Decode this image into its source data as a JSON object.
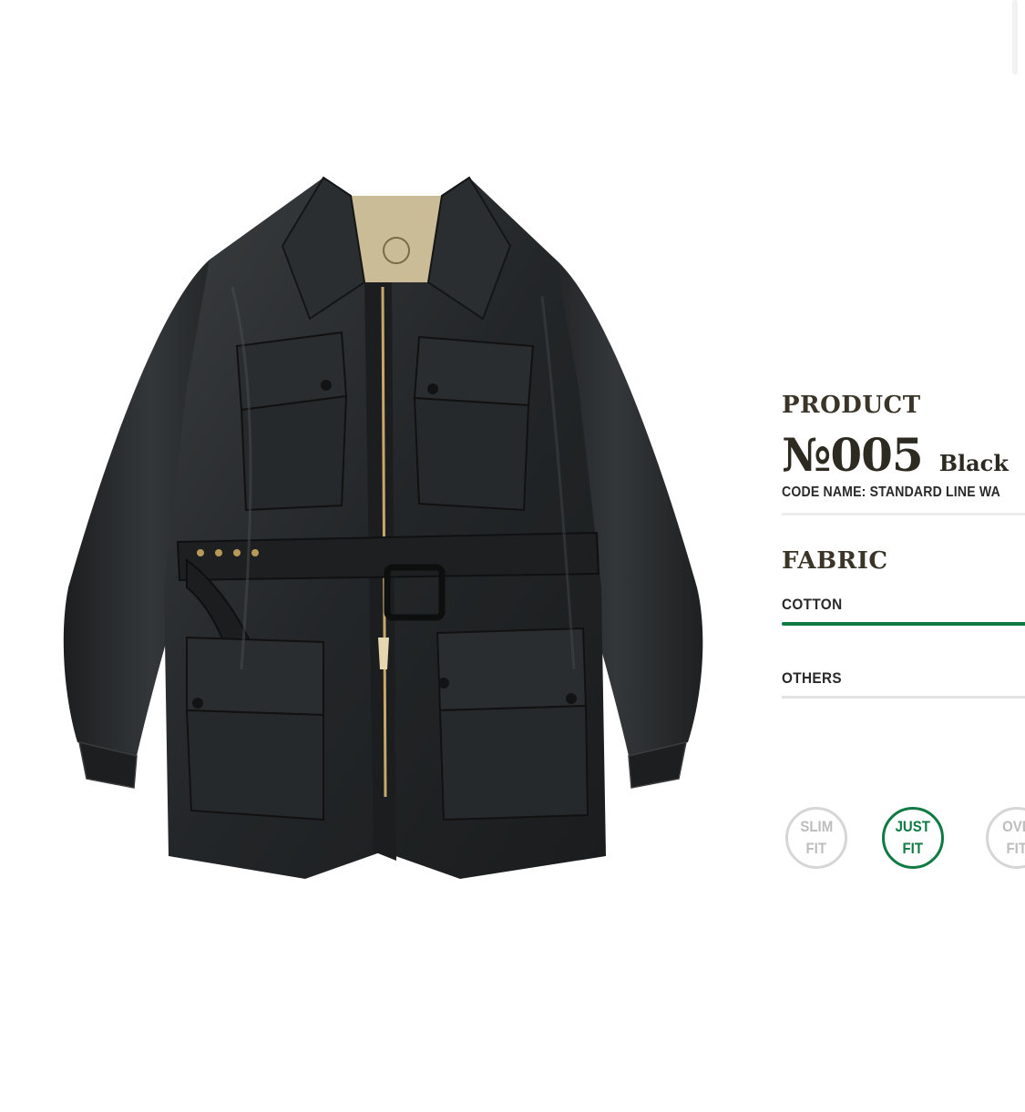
{
  "product": {
    "heading": "PRODUCT",
    "number": "№005",
    "color": "Black",
    "code_name": "CODE NAME: STANDARD LINE WA"
  },
  "fabric": {
    "heading": "FABRIC",
    "tabs": [
      {
        "label": "COTTON",
        "active": true
      },
      {
        "label": "OTHERS",
        "active": false
      }
    ]
  },
  "fit_options": [
    {
      "line1": "SLIM",
      "line2": "FIT",
      "selected": false
    },
    {
      "line1": "JUST",
      "line2": "FIT",
      "selected": true
    },
    {
      "line1": "OVE",
      "line2": "FIT",
      "selected": false
    }
  ],
  "colors": {
    "accent_green": "#0f7a43",
    "jacket": "#25282a"
  },
  "icons": {
    "product_image": "black-waxed-cotton-jacket-image"
  }
}
